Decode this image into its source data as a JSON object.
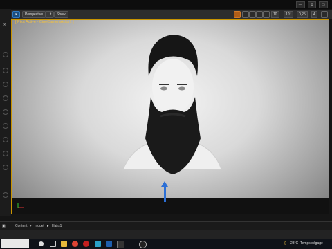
{
  "viewport": {
    "perspective_label": "Perspective",
    "lit_label": "Lit",
    "show_label": "Show",
    "pilot_label": "[ Pilot Active - CineCameraActor1 ]",
    "snap_values": [
      "10",
      "10°",
      "0,25"
    ],
    "camera_speed": "4"
  },
  "content_browser": {
    "label": "Content",
    "path": [
      "model",
      "Hairs1"
    ]
  },
  "taskbar": {
    "weather_temp": "23°C",
    "weather_text": "Temps dégagé"
  },
  "colors": {
    "viewport_border": "#c99400",
    "accent_blue": "#2b6fd6",
    "active_button": "#1c4e80"
  }
}
